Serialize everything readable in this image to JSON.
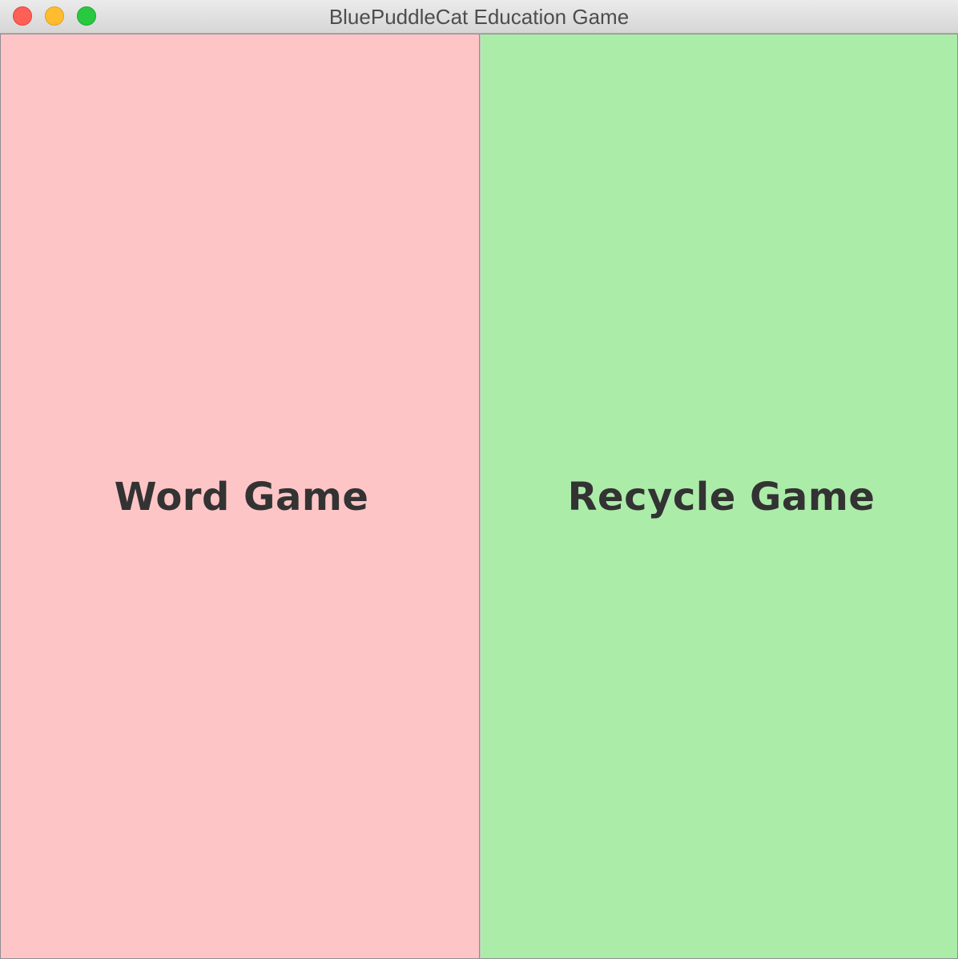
{
  "window": {
    "title": "BluePuddleCat Education Game"
  },
  "games": [
    {
      "label": "Word Game",
      "color": "#fec5c6"
    },
    {
      "label": "Recycle Game",
      "color": "#aceca9"
    }
  ],
  "colors": {
    "close": "#fe5f57",
    "minimize": "#febc2e",
    "zoom": "#28c840"
  }
}
